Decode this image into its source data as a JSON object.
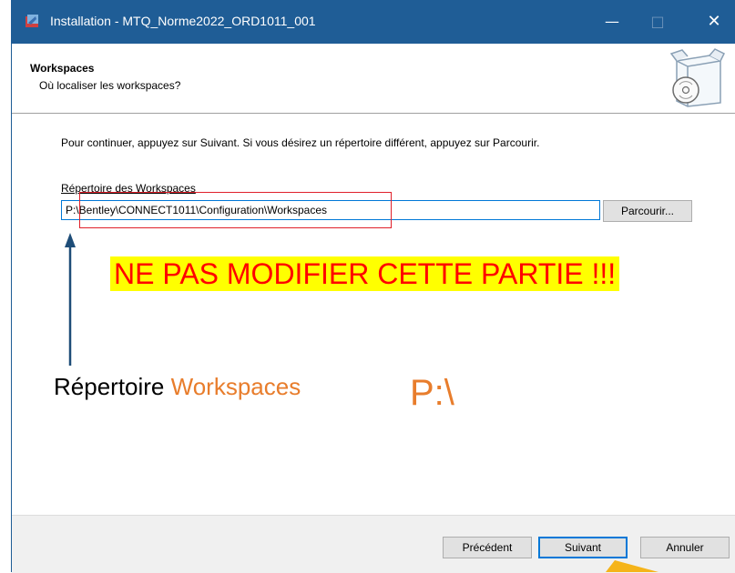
{
  "window": {
    "title": "Installation - MTQ_Norme2022_ORD1011_001"
  },
  "titlebar": {
    "minimize": "—",
    "maximize": "□",
    "close": "✕"
  },
  "header": {
    "title": "Workspaces",
    "subtitle": "Où localiser les workspaces?"
  },
  "content": {
    "instruction": "Pour continuer, appuyez sur Suivant. Si vous désirez un répertoire différent, appuyez sur Parcourir.",
    "dir_label": "Répertoire des Workspaces",
    "dir_value": "P:\\Bentley\\CONNECT1011\\Configuration\\Workspaces",
    "browse_label": "Parcourir..."
  },
  "annotations": {
    "warning": "NE PAS MODIFIER CETTE PARTIE !!!",
    "label_prefix": "Répertoire",
    "label_highlight": "Workspaces",
    "drive": "P:\\"
  },
  "footer": {
    "prev_label": "Précédent",
    "next_label": "Suivant",
    "cancel_label": "Annuler"
  },
  "colors": {
    "titlebar": "#1f5d96",
    "accent": "#0078d7",
    "annotation_orange": "#e87d2c",
    "warning_bg": "#ffff00",
    "warning_text": "#ff0000"
  }
}
